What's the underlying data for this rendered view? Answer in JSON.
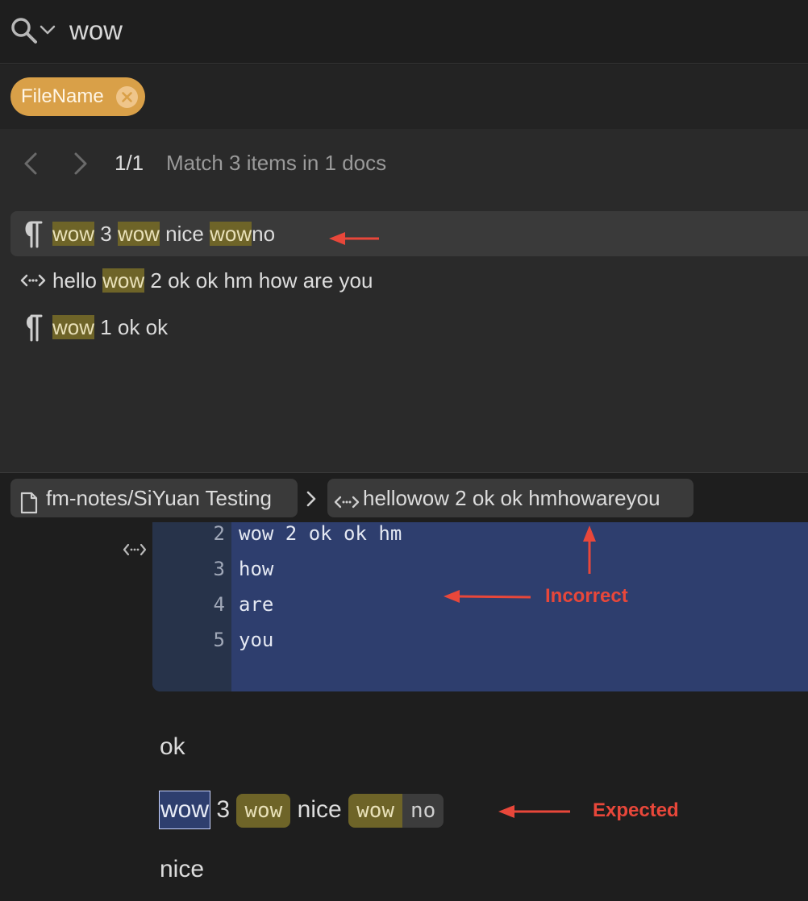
{
  "search": {
    "query": "wow"
  },
  "filter": {
    "chip_label": "FileName"
  },
  "results": {
    "page_indicator": "1/1",
    "match_summary": "Match 3 items in 1 docs",
    "rows": [
      {
        "icon": "paragraph-icon",
        "segments": [
          [
            "wow",
            true
          ],
          [
            " 3 ",
            false
          ],
          [
            "wow",
            true
          ],
          [
            " nice ",
            false
          ],
          [
            "wow",
            true
          ],
          [
            "no",
            false
          ]
        ]
      },
      {
        "icon": "code-block-icon",
        "segments": [
          [
            "hello ",
            false
          ],
          [
            "wow",
            true
          ],
          [
            " 2 ok ok hm how are you",
            false
          ]
        ]
      },
      {
        "icon": "paragraph-icon",
        "segments": [
          [
            "wow",
            true
          ],
          [
            " 1 ok ok",
            false
          ]
        ]
      }
    ]
  },
  "breadcrumb": {
    "doc_path": "fm-notes/SiYuan Testing",
    "block_label": "hellowow 2 ok ok hmhowareyou"
  },
  "editor": {
    "code_lines": [
      {
        "num": "2",
        "text": "wow 2 ok ok hm"
      },
      {
        "num": "3",
        "text": "how"
      },
      {
        "num": "4",
        "text": "are"
      },
      {
        "num": "5",
        "text": "you"
      }
    ],
    "para_ok": "ok",
    "para_wow_sel": "wow",
    "para_wow_3": " 3 ",
    "para_wow_pill1": "wow",
    "para_wow_nice": " nice ",
    "para_wow_pill2": "wow",
    "para_wow_no": "no",
    "para_nice": "nice"
  },
  "annotations": {
    "incorrect": "Incorrect",
    "expected": "Expected"
  },
  "colors": {
    "accent_chip": "#d9a048",
    "highlight": "#6e6428",
    "code_block_bg": "#2e3e6e",
    "annotation": "#e8473a"
  }
}
